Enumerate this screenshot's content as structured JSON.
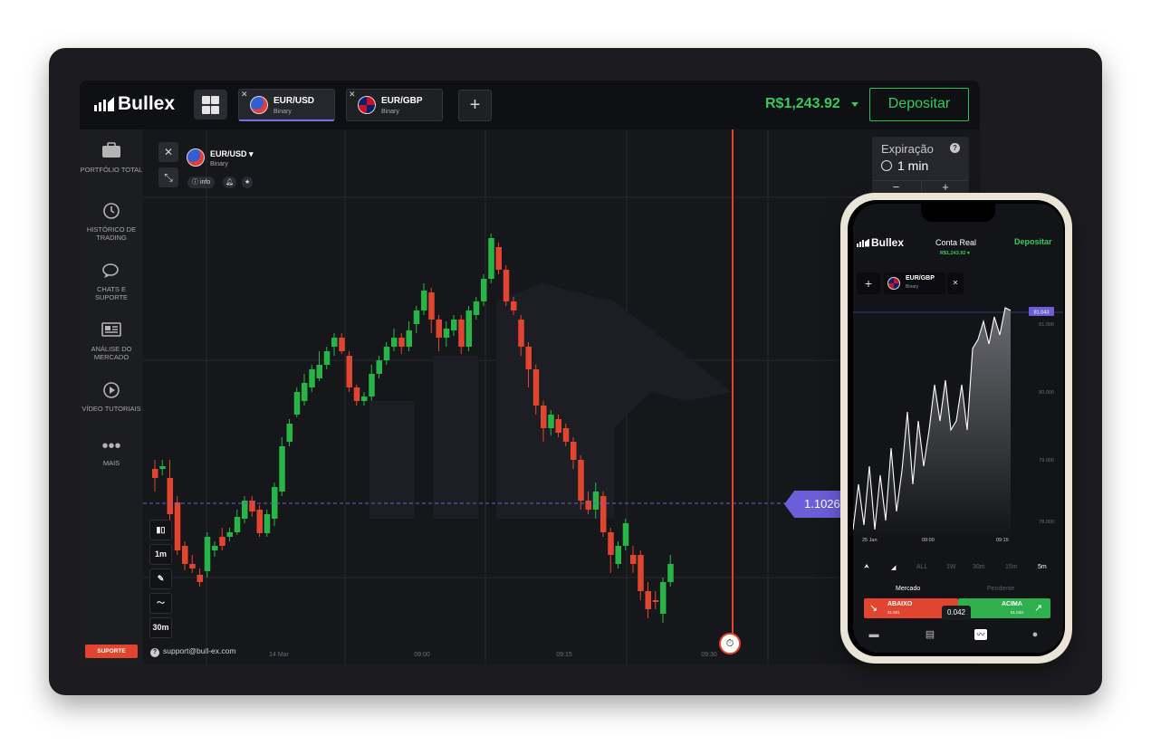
{
  "header": {
    "logo_text": "Bullex",
    "tabs": [
      {
        "pair": "EUR/USD",
        "type": "Binary"
      },
      {
        "pair": "EUR/GBP",
        "type": "Binary"
      }
    ],
    "add_tab_label": "+",
    "balance": "R$1,243.92",
    "deposit_label": "Depositar"
  },
  "sidebar": {
    "items": [
      {
        "label": "PORTFÓLIO TOTAL",
        "icon": "briefcase-icon"
      },
      {
        "label": "HISTÓRICO DE TRADING",
        "icon": "history-icon"
      },
      {
        "label": "CHATS E SUPORTE",
        "icon": "chat-icon"
      },
      {
        "label": "ANÁLISE DO MERCADO",
        "icon": "news-icon"
      },
      {
        "label": "VÍDEO TUTORIAIS",
        "icon": "play-icon"
      },
      {
        "label": "MAIS",
        "icon": "more-icon"
      }
    ],
    "support_label": "SUPORTE",
    "support_email": "support@bull-ex.com"
  },
  "chart_panel": {
    "pair": "EUR/USD",
    "type": "Binary",
    "info_label": "info",
    "tools": [
      "1m",
      "30m"
    ],
    "current_price": "1.1026",
    "time_labels": [
      "14 Mar",
      "09:00",
      "09:15",
      "09:30"
    ],
    "colors": {
      "up": "#27b548",
      "down": "#e2452f",
      "price_line": "#6b5fd8"
    }
  },
  "expiry": {
    "label": "Expiração",
    "value": "1 min",
    "minus": "−",
    "plus": "+"
  },
  "phone": {
    "logo_text": "Bullex",
    "title": "Conta Real",
    "balance": "R$1,243.92",
    "deposit_label": "Depositar",
    "tab": {
      "pair": "EUR/GBP",
      "type": "Binary"
    },
    "price_tag": "81.043",
    "y_labels": [
      "81.000",
      "80.000",
      "79.000",
      "78.000"
    ],
    "x_labels": [
      "25 Jan",
      "09:00",
      "09:15"
    ],
    "timeframes": [
      "ALL",
      "1W",
      "30m",
      "15m",
      "5m"
    ],
    "market_label": "Mercado",
    "pending_label": "Pendente",
    "down": {
      "label": "ABAIXO",
      "value": "21.501"
    },
    "up": {
      "label": "ACIMA",
      "value": "81.043"
    },
    "mid_value": "0.042"
  },
  "chart_data": {
    "type": "candlestick",
    "x_labels": [
      "14 Mar",
      "09:00",
      "09:15",
      "09:30"
    ],
    "current_price": 1.1026,
    "candles_count": 60
  }
}
